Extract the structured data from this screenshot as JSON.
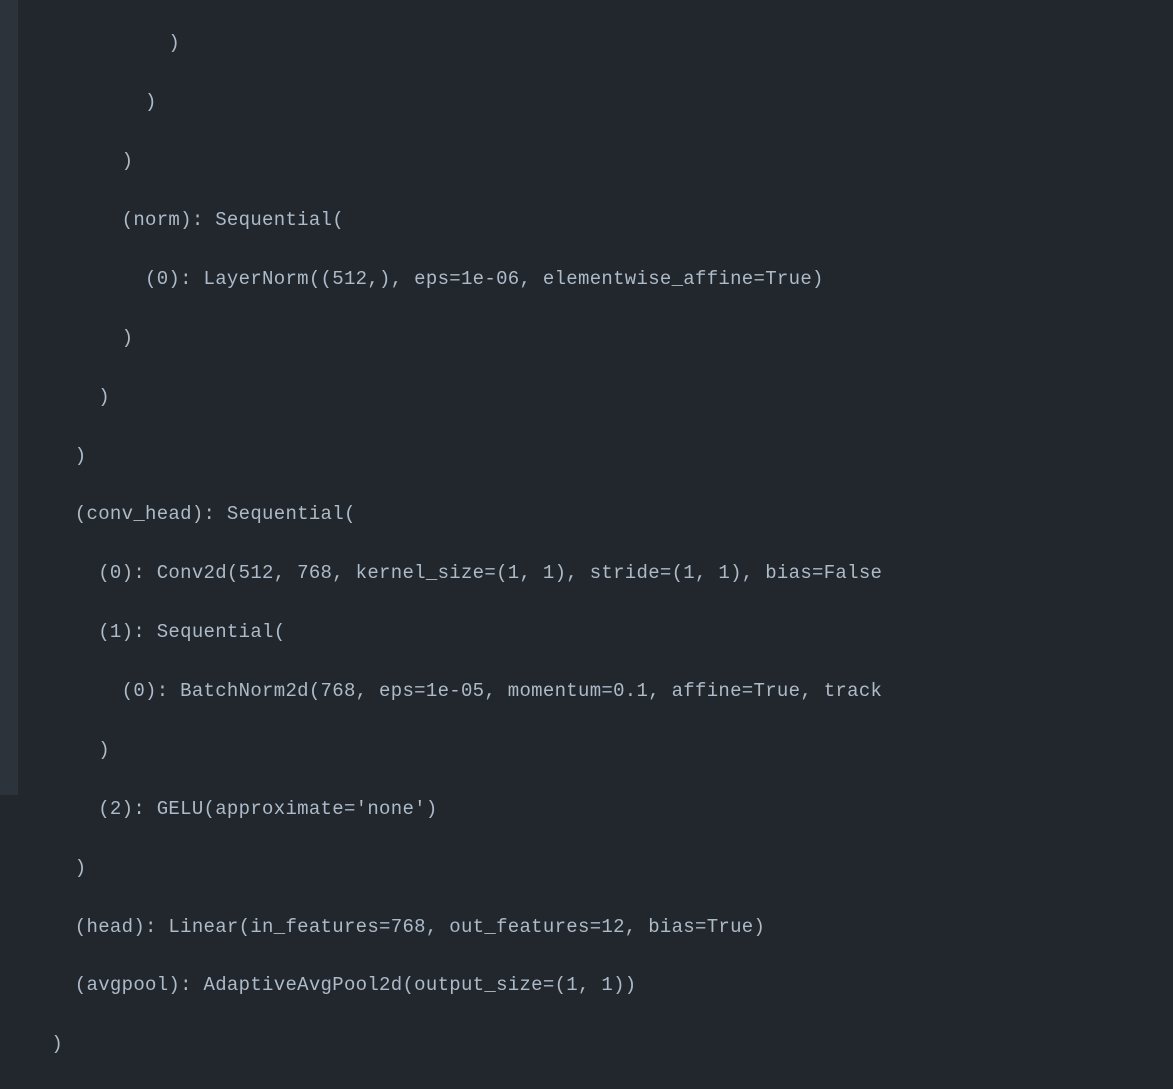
{
  "code": {
    "lines": [
      "            )",
      "          )",
      "        )",
      "        (norm): Sequential(",
      "          (0): LayerNorm((512,), eps=1e-06, elementwise_affine=True)",
      "        )",
      "      )",
      "    )",
      "    (conv_head): Sequential(",
      "      (0): Conv2d(512, 768, kernel_size=(1, 1), stride=(1, 1), bias=False",
      "      (1): Sequential(",
      "        (0): BatchNorm2d(768, eps=1e-05, momentum=0.1, affine=True, track",
      "      )",
      "      (2): GELU(approximate='none')",
      "    )",
      "    (head): Linear(in_features=768, out_features=12, bias=True)",
      "    (avgpool): AdaptiveAvgPool2d(output_size=(1, 1))",
      "  )"
    ]
  }
}
